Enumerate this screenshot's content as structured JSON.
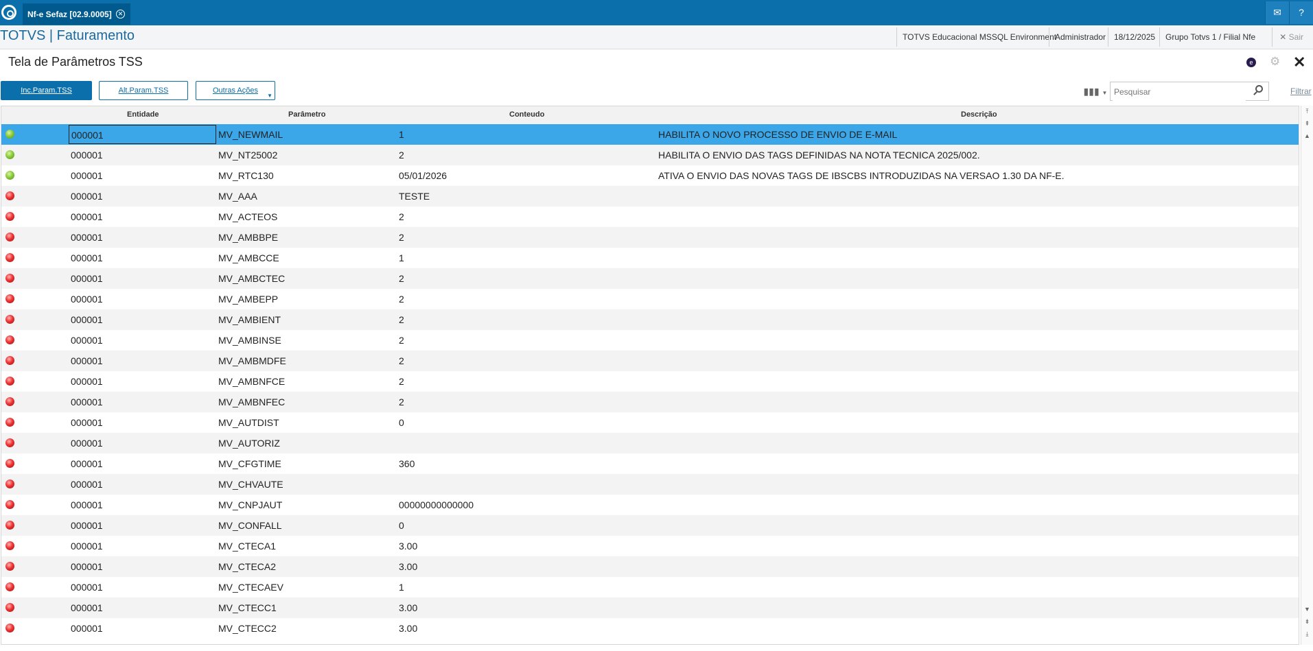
{
  "topbar": {
    "tab_label": "Nf-e Sefaz [02.9.0005]",
    "tab_close": "✕",
    "mail_icon": "✉",
    "help_icon": "?"
  },
  "header": {
    "app_title": "TOTVS | Faturamento",
    "environment": "TOTVS Educacional MSSQL Environment",
    "user": "Administrador",
    "date": "18/12/2025",
    "company": "Grupo Totvs 1 / Filial Nfe",
    "exit_label": "Sair"
  },
  "page": {
    "title": "Tela de Parâmetros TSS"
  },
  "toolbar": {
    "inc_label": "Inc.Param.TSS",
    "alt_label": "Alt.Param.TSS",
    "more_label": "Outras Ações",
    "search_placeholder": "Pesquisar",
    "filter_label": "Filtrar"
  },
  "grid": {
    "columns": [
      "Entidade",
      "Parâmetro",
      "Conteudo",
      "Descrição"
    ],
    "rows": [
      {
        "status": "green",
        "entidade": "000001",
        "parametro": "MV_NEWMAIL",
        "conteudo": "1",
        "descricao": "HABILITA O NOVO PROCESSO DE ENVIO DE E-MAIL",
        "selected": true
      },
      {
        "status": "green",
        "entidade": "000001",
        "parametro": "MV_NT25002",
        "conteudo": "2",
        "descricao": "HABILITA O ENVIO DAS TAGS DEFINIDAS NA NOTA TECNICA 2025/002."
      },
      {
        "status": "green",
        "entidade": "000001",
        "parametro": "MV_RTC130",
        "conteudo": "05/01/2026",
        "descricao": "ATIVA O ENVIO DAS NOVAS TAGS DE IBSCBS INTRODUZIDAS NA VERSAO 1.30 DA NF-E."
      },
      {
        "status": "red",
        "entidade": "000001",
        "parametro": "MV_AAA",
        "conteudo": "TESTE",
        "descricao": ""
      },
      {
        "status": "red",
        "entidade": "000001",
        "parametro": "MV_ACTEOS",
        "conteudo": "2",
        "descricao": ""
      },
      {
        "status": "red",
        "entidade": "000001",
        "parametro": "MV_AMBBPE",
        "conteudo": "2",
        "descricao": ""
      },
      {
        "status": "red",
        "entidade": "000001",
        "parametro": "MV_AMBCCE",
        "conteudo": "1",
        "descricao": ""
      },
      {
        "status": "red",
        "entidade": "000001",
        "parametro": "MV_AMBCTEC",
        "conteudo": "2",
        "descricao": ""
      },
      {
        "status": "red",
        "entidade": "000001",
        "parametro": "MV_AMBEPP",
        "conteudo": "2",
        "descricao": ""
      },
      {
        "status": "red",
        "entidade": "000001",
        "parametro": "MV_AMBIENT",
        "conteudo": "2",
        "descricao": ""
      },
      {
        "status": "red",
        "entidade": "000001",
        "parametro": "MV_AMBINSE",
        "conteudo": "2",
        "descricao": ""
      },
      {
        "status": "red",
        "entidade": "000001",
        "parametro": "MV_AMBMDFE",
        "conteudo": "2",
        "descricao": ""
      },
      {
        "status": "red",
        "entidade": "000001",
        "parametro": "MV_AMBNFCE",
        "conteudo": "2",
        "descricao": ""
      },
      {
        "status": "red",
        "entidade": "000001",
        "parametro": "MV_AMBNFEC",
        "conteudo": "2",
        "descricao": ""
      },
      {
        "status": "red",
        "entidade": "000001",
        "parametro": "MV_AUTDIST",
        "conteudo": "0",
        "descricao": ""
      },
      {
        "status": "red",
        "entidade": "000001",
        "parametro": "MV_AUTORIZ",
        "conteudo": "",
        "descricao": ""
      },
      {
        "status": "red",
        "entidade": "000001",
        "parametro": "MV_CFGTIME",
        "conteudo": "360",
        "descricao": ""
      },
      {
        "status": "red",
        "entidade": "000001",
        "parametro": "MV_CHVAUTE",
        "conteudo": "",
        "descricao": ""
      },
      {
        "status": "red",
        "entidade": "000001",
        "parametro": "MV_CNPJAUT",
        "conteudo": "00000000000000",
        "descricao": ""
      },
      {
        "status": "red",
        "entidade": "000001",
        "parametro": "MV_CONFALL",
        "conteudo": "0",
        "descricao": ""
      },
      {
        "status": "red",
        "entidade": "000001",
        "parametro": "MV_CTECA1",
        "conteudo": "3.00",
        "descricao": ""
      },
      {
        "status": "red",
        "entidade": "000001",
        "parametro": "MV_CTECA2",
        "conteudo": "3.00",
        "descricao": ""
      },
      {
        "status": "red",
        "entidade": "000001",
        "parametro": "MV_CTECAEV",
        "conteudo": "1",
        "descricao": ""
      },
      {
        "status": "red",
        "entidade": "000001",
        "parametro": "MV_CTECC1",
        "conteudo": "3.00",
        "descricao": ""
      },
      {
        "status": "red",
        "entidade": "000001",
        "parametro": "MV_CTECC2",
        "conteudo": "3.00",
        "descricao": ""
      }
    ]
  },
  "colors": {
    "brand": "#0a6fab",
    "selected_row": "#3ba6e8",
    "status_green": "#8ccb3c",
    "status_red": "#e33333"
  }
}
